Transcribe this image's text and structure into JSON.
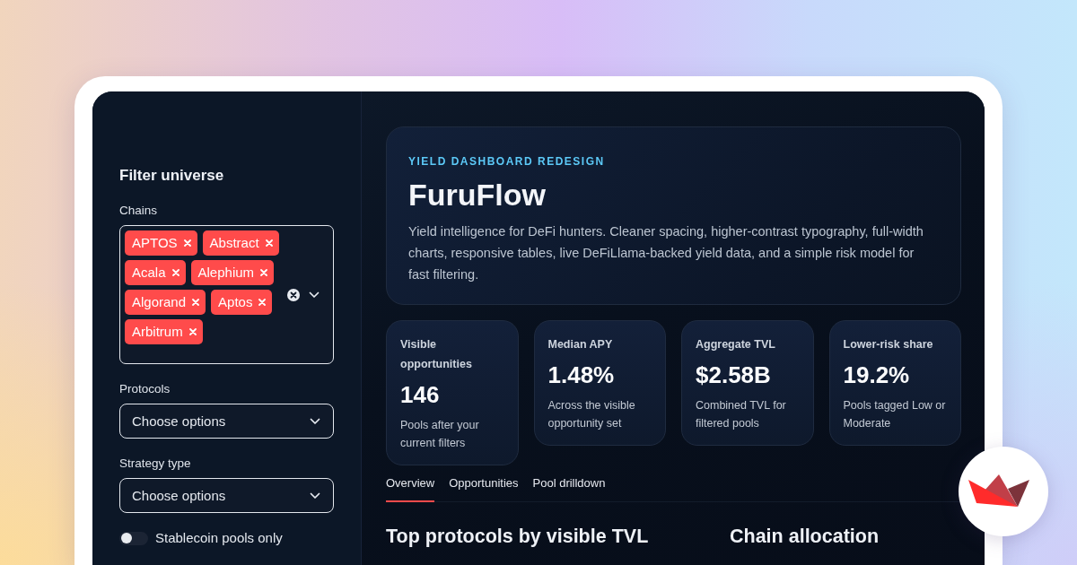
{
  "sidebar": {
    "title": "Filter universe",
    "filters": [
      {
        "kind": "multiselect",
        "label": "Chains",
        "tags": [
          "APTOS",
          "Abstract",
          "Acala",
          "Alephium",
          "Algorand",
          "Aptos",
          "Arbitrum"
        ]
      },
      {
        "kind": "select",
        "label": "Protocols",
        "placeholder": "Choose options"
      },
      {
        "kind": "select",
        "label": "Strategy type",
        "placeholder": "Choose options"
      },
      {
        "kind": "toggle",
        "label": "Stablecoin pools only",
        "on": false
      }
    ]
  },
  "hero": {
    "kicker": "YIELD DASHBOARD REDESIGN",
    "title": "FuruFlow",
    "description": "Yield intelligence for DeFi hunters. Cleaner spacing, higher-contrast typography, full-width charts, responsive tables, live DeFiLlama-backed yield data, and a simple risk model for fast filtering."
  },
  "metrics": [
    {
      "label": "Visible opportunities",
      "value": "146",
      "caption": "Pools after your current filters"
    },
    {
      "label": "Median APY",
      "value": "1.48%",
      "caption": "Across the visible opportunity set"
    },
    {
      "label": "Aggregate TVL",
      "value": "$2.58B",
      "caption": "Combined TVL for filtered pools"
    },
    {
      "label": "Lower-risk share",
      "value": "19.2%",
      "caption": "Pools tagged Low or Moderate"
    }
  ],
  "tabs": [
    {
      "label": "Overview",
      "selected": true
    },
    {
      "label": "Opportunities",
      "selected": false
    },
    {
      "label": "Pool drilldown",
      "selected": false
    }
  ],
  "sections": [
    {
      "title": "Top protocols by visible TVL"
    },
    {
      "title": "Chain allocation"
    }
  ]
}
